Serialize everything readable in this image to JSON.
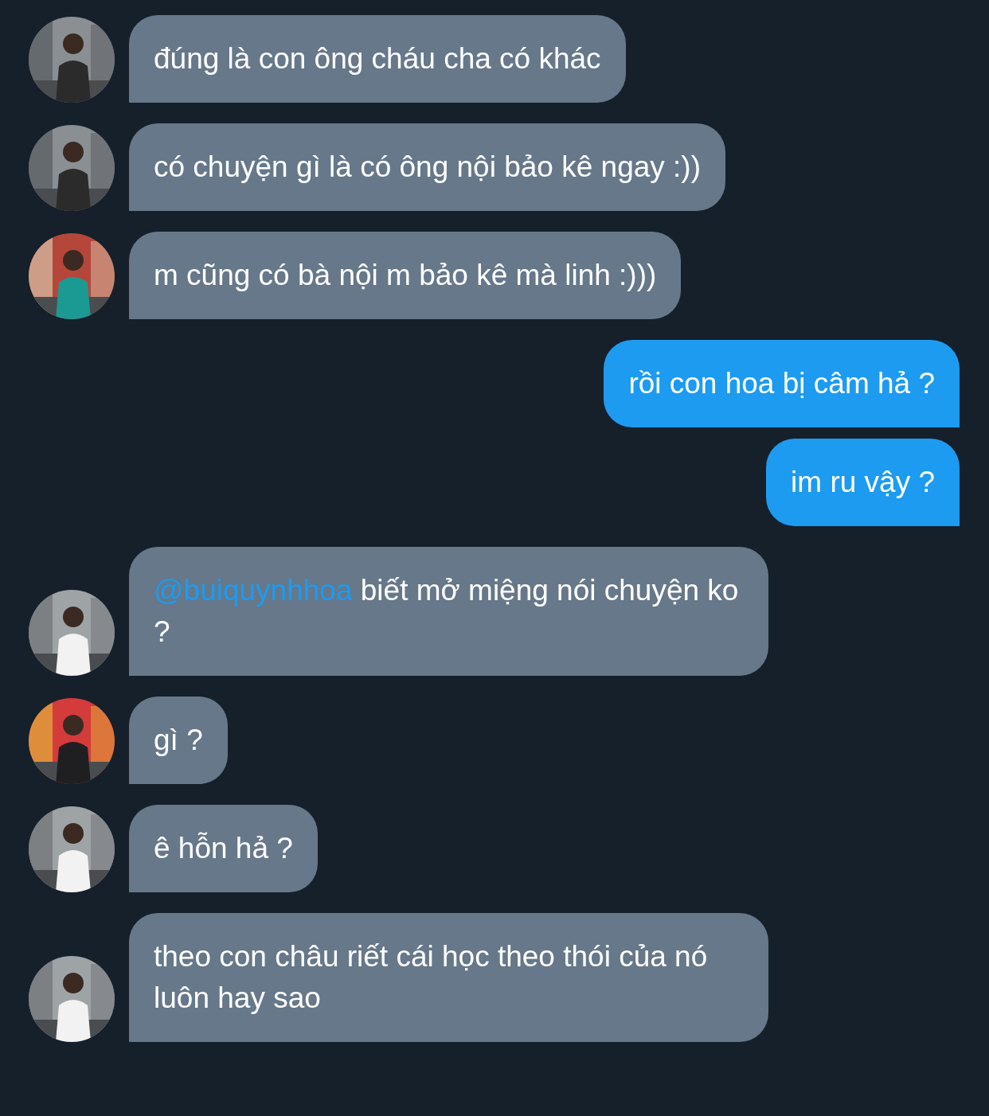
{
  "messages": [
    {
      "kind": "received",
      "text": "đúng là con ông cháu cha có khác"
    },
    {
      "kind": "received",
      "text": "có chuyện gì là có ông nội bảo kê ngay :))"
    },
    {
      "kind": "received",
      "text": "m cũng có bà nội m bảo kê mà linh :)))"
    },
    {
      "kind": "sent",
      "text": "rồi con hoa bị câm hả ?"
    },
    {
      "kind": "sent",
      "text": "im ru vậy ?"
    },
    {
      "kind": "received",
      "mention": "@buiquynhhoa",
      "text": "biết mở miệng nói chuyện ko ?"
    },
    {
      "kind": "received",
      "text": "gì ?"
    },
    {
      "kind": "received",
      "text": "ê hỗn hả ?"
    },
    {
      "kind": "received",
      "text": "theo con châu riết cái học theo thói của nó luôn hay sao"
    }
  ]
}
